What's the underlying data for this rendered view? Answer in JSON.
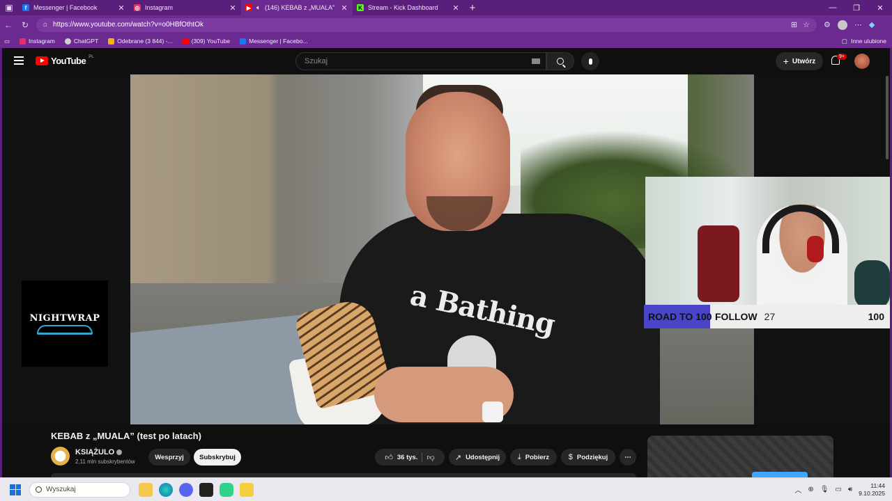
{
  "browser": {
    "tabs": [
      {
        "title": "Messenger | Facebook",
        "icon": "facebook-icon",
        "color": "#1877f2",
        "active": false
      },
      {
        "title": "Instagram",
        "icon": "instagram-icon",
        "color": "#e1306c",
        "active": false
      },
      {
        "title": "(146) KEBAB z „MUALA” (test",
        "icon": "youtube-icon",
        "color": "#ff0000",
        "active": true
      },
      {
        "title": "Stream - Kick Dashboard",
        "icon": "kick-icon",
        "color": "#53fc18",
        "active": false
      }
    ],
    "url": "https://www.youtube.com/watch?v=o0HBfOthtOk",
    "bookmarks": [
      {
        "label": "Instagram",
        "color": "#e1306c"
      },
      {
        "label": "ChatGPT",
        "color": "#d0d0d0"
      },
      {
        "label": "Odebrane (3 844) -...",
        "color": "#f4b400"
      },
      {
        "label": "(309) YouTube",
        "color": "#ff0000"
      },
      {
        "label": "Messenger | Facebo...",
        "color": "#1877f2"
      }
    ],
    "other_bookmarks": "Inne ulubione"
  },
  "youtube": {
    "logo_word": "YouTube",
    "country_code": "PL",
    "search_placeholder": "Szukaj",
    "create_label": "Utwórz",
    "notif_badge": "9+"
  },
  "overlay": {
    "brand": "NIGHTWRAP",
    "goal_label": "ROAD TO 100",
    "goal_type": "FOLLOW",
    "current": "27",
    "target": "100",
    "progress_fraction": 0.27
  },
  "video": {
    "title": "KEBAB z „MUALA” (test po latach)",
    "channel": "KSIĄŻULO",
    "subscribers": "2,11 mln subskrybentów",
    "support_label": "Wesprzyj",
    "subscribe_label": "Subskrybuj",
    "likes": "36 tys.",
    "share_label": "Udostępnij",
    "download_label": "Pobierz",
    "thanks_label": "Podziękuj"
  },
  "taskbar": {
    "search_placeholder": "Wyszukaj",
    "time": "11:44",
    "date": "9.10.2025"
  }
}
